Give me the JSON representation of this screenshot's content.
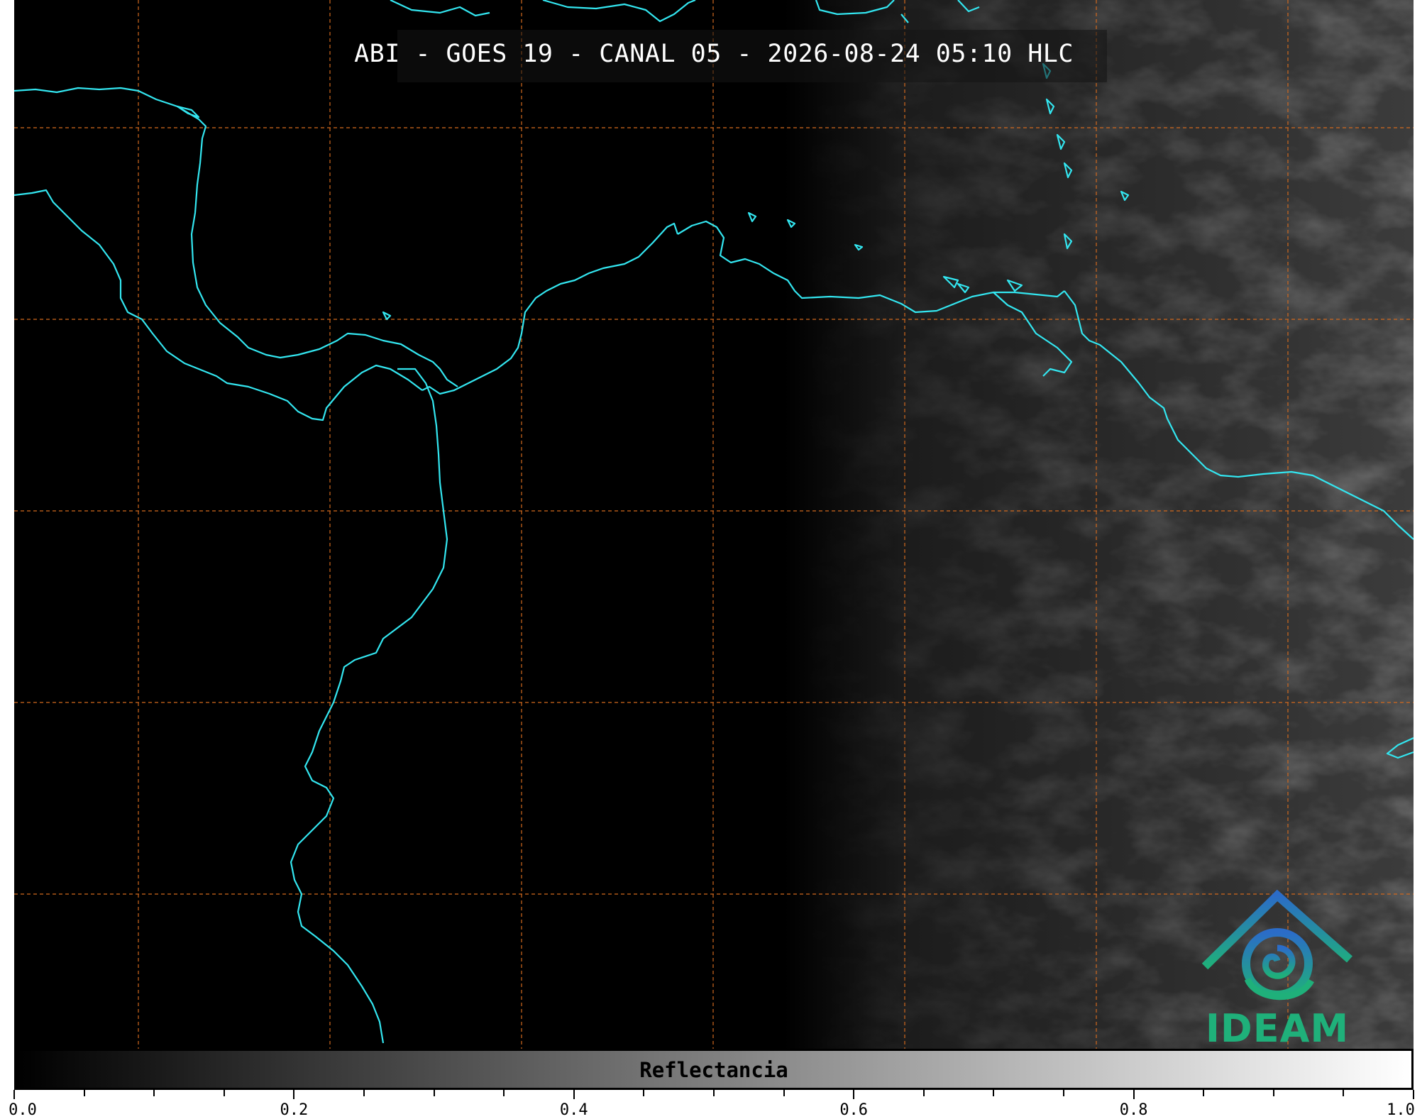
{
  "title": "ABI - GOES 19 - CANAL 05 - 2026-08-24 05:10 HLC",
  "colorbar": {
    "label": "Reflectancia",
    "ticks": [
      "0.0",
      "0.2",
      "0.4",
      "0.6",
      "0.8",
      "1.0"
    ],
    "range": [
      0.0,
      1.0
    ],
    "colormap": [
      "#000000",
      "#ffffff"
    ]
  },
  "logo": {
    "text": "IDEAM",
    "color_top": "#2b6cc8",
    "color_bottom": "#1fb07a"
  },
  "map": {
    "background": "#000000",
    "coastline_color": "#33e6f0",
    "gridline_color": "#d2691e",
    "gridline_style": "dashed",
    "channel": "CANAL 05",
    "satellite": "GOES 19",
    "instrument": "ABI"
  }
}
